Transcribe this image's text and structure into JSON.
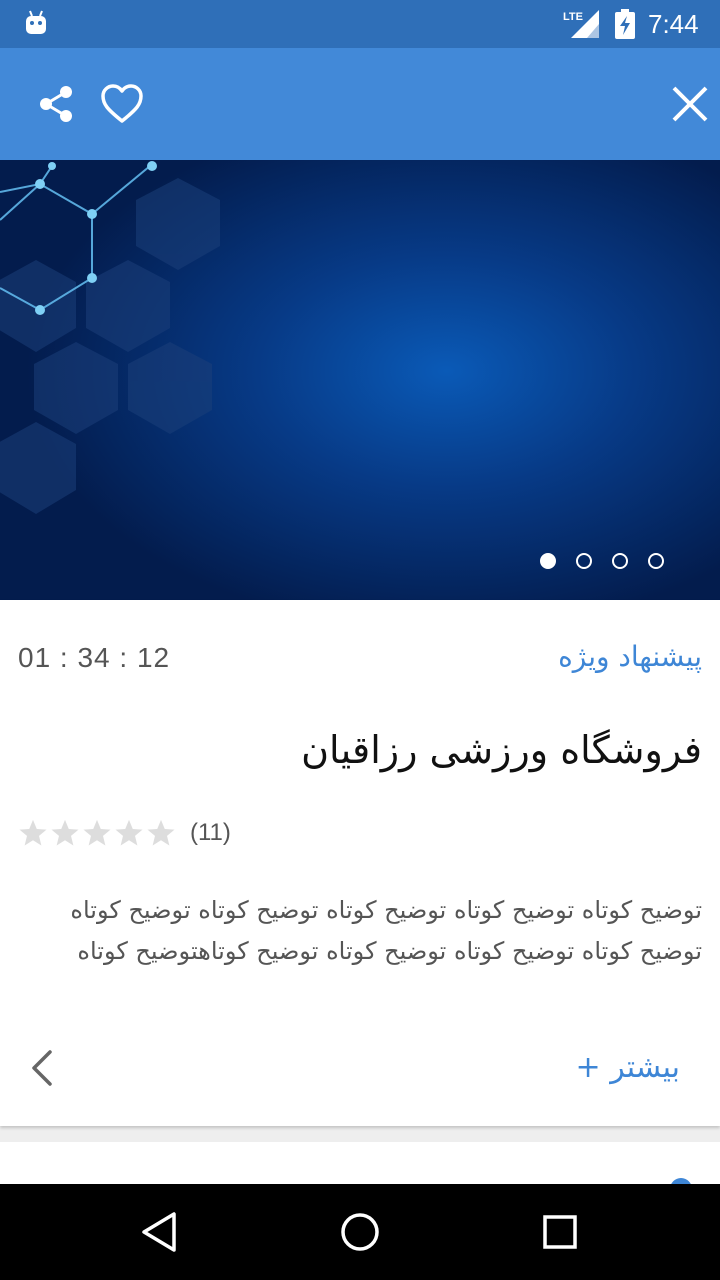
{
  "status_bar": {
    "time": "7:44",
    "network": "LTE",
    "icons": [
      "android-icon",
      "lte-signal-icon",
      "battery-charging-icon"
    ]
  },
  "app_bar": {
    "icons": [
      "share-icon",
      "favorite-heart-icon",
      "close-icon"
    ]
  },
  "hero": {
    "page_count": 4,
    "active_page": 0
  },
  "offer": {
    "badge": "پیشنهاد ویژه",
    "countdown": "01 : 34 : 12",
    "title": "فروشگاه ورزشی رزاقیان",
    "rating": 0,
    "rating_max": 5,
    "review_count": "(11)",
    "description": "توضیح کوتاه توضیح کوتاه توضیح کوتاه توضیح کوتاه توضیح کوتاه توضیح کوتاه توضیح کوتاه توضیح کوتاه توضیح کوتاهتوضیح کوتاه",
    "more_label": "بیشتر +"
  },
  "colors": {
    "status_bar": "#2f6fb8",
    "app_bar": "#4289d8",
    "accent": "#3e86d6",
    "star_empty": "#dddddd"
  },
  "nav_bar": {
    "icons": [
      "back-triangle-icon",
      "home-circle-icon",
      "recents-square-icon"
    ]
  }
}
